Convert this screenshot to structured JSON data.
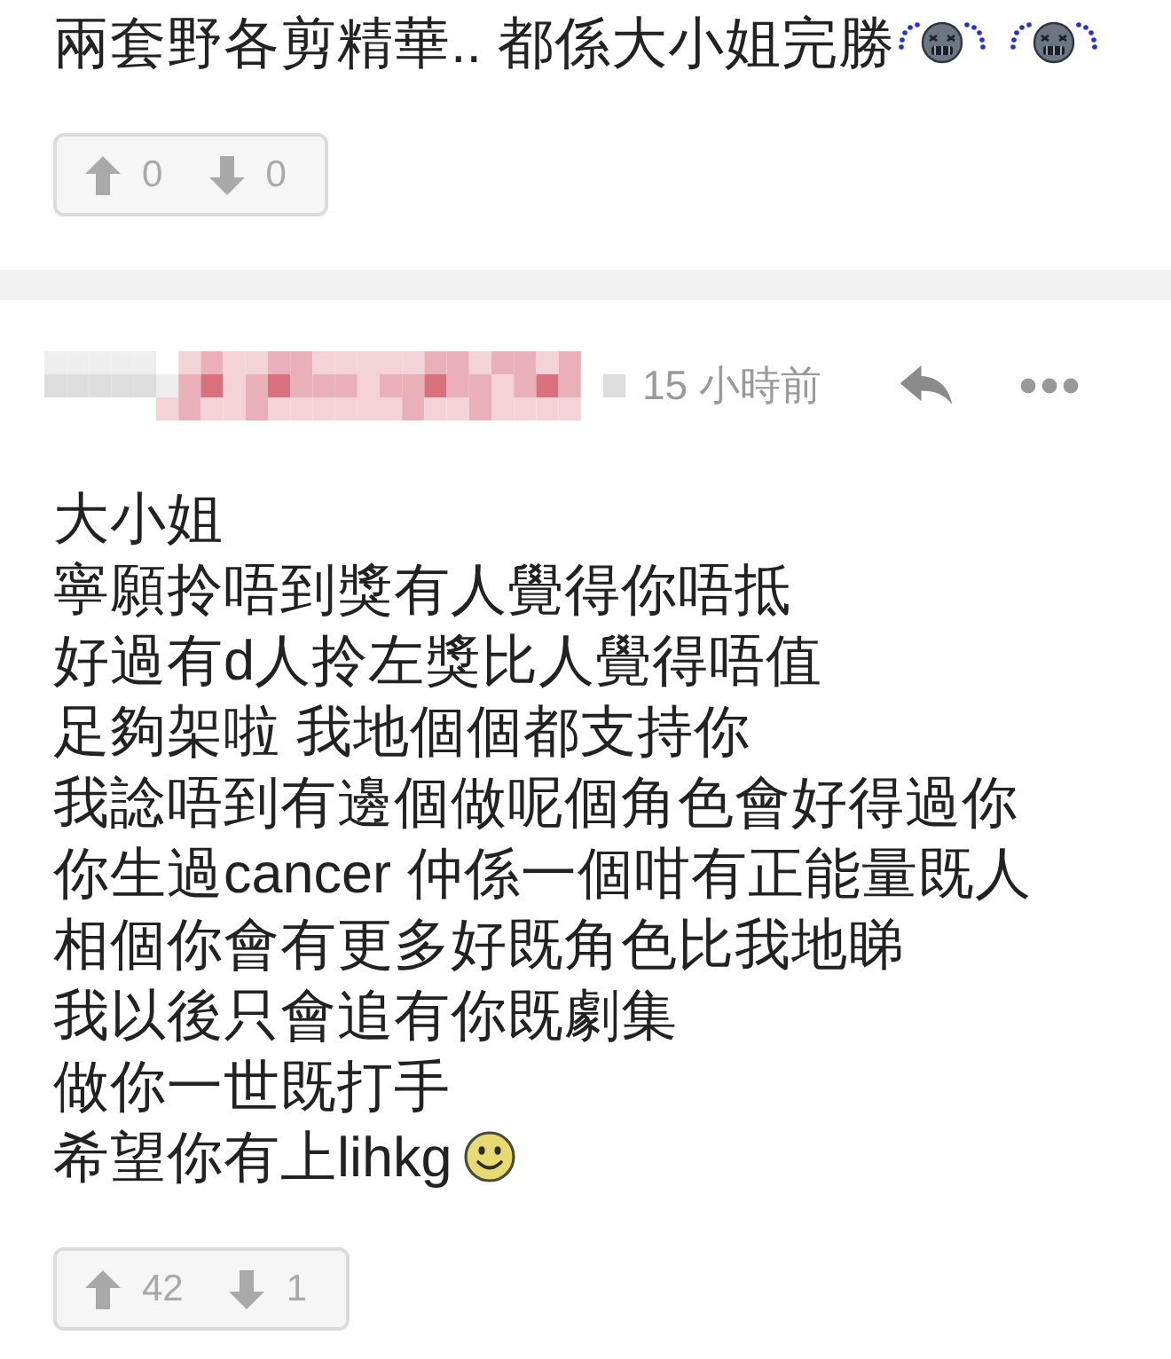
{
  "comments": [
    {
      "lines": [
        {
          "text": "兩套野各剪精華.. 都係大小姐完勝",
          "emojis": [
            {
              "kind": "cry"
            },
            {
              "kind": "cry"
            }
          ]
        }
      ],
      "votes": {
        "up": "0",
        "down": "0"
      }
    },
    {
      "header": {
        "time": "15 小時前"
      },
      "lines": [
        {
          "text": "大小姐"
        },
        {
          "text": "寧願拎唔到獎有人覺得你唔抵"
        },
        {
          "text": "好過有d人拎左獎比人覺得唔值"
        },
        {
          "text": "足夠架啦 我地個個都支持你"
        },
        {
          "text": "我諗唔到有邊個做呢個角色會好得過你"
        },
        {
          "text": "你生過cancer 仲係一個咁有正能量既人"
        },
        {
          "text": "相個你會有更多好既角色比我地睇"
        },
        {
          "text": "我以後只會追有你既劇集"
        },
        {
          "text": "做你一世既打手"
        },
        {
          "text": "希望你有上lihkg",
          "emojis": [
            {
              "kind": "smile"
            }
          ]
        }
      ],
      "votes": {
        "up": "42",
        "down": "1"
      }
    }
  ]
}
